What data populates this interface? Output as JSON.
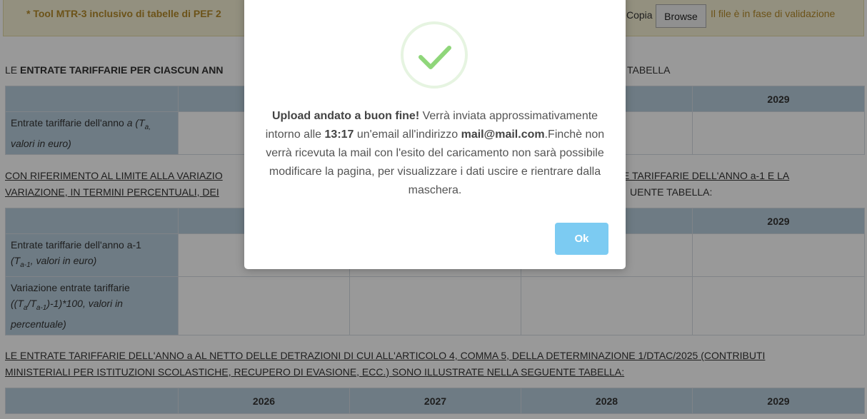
{
  "notice": {
    "text": "* Tool MTR-3 inclusivo di tabelle di PEF 2",
    "copy_label": "Copia (",
    "browse_label": "Browse",
    "status": "Il file è in fase di validazione"
  },
  "section1": {
    "heading_prefix": "LE ",
    "heading_bold": "ENTRATE TARIFFARIE PER CIASCUN ANN",
    "heading_suffix": "TABELLA",
    "years": [
      "",
      "",
      "",
      "2029"
    ],
    "row_label_a": "Entrate tariffarie dell'anno ",
    "row_label_b": "a (T",
    "row_label_c": "a,",
    "row_label_d": "valori in euro)"
  },
  "section2": {
    "heading_line1_left": "CON RIFERIMENTO AL LIMITE ALLA VARIAZIO",
    "heading_line1_right": "E TARIFFARIE DELL'ANNO a-1 E LA",
    "heading_line2_left": "VARIAZIONE, IN TERMINI PERCENTUALI, DEI",
    "heading_line2_right": "UENTE TABELLA:",
    "years": [
      "",
      "",
      "",
      "2029"
    ],
    "row1_label_a": "Entrate tariffarie dell'anno a-1",
    "row1_label_b": "(T",
    "row1_label_sub": "a-1",
    "row1_label_c": ", valori in euro)",
    "row2_label_a": "Variazione entrate tariffarie",
    "row2_label_b": "((T",
    "row2_label_sub1": "a",
    "row2_label_c": "/T",
    "row2_label_sub2": "a-1",
    "row2_label_d": ")-1)*100, valori in",
    "row2_label_e": "percentuale)"
  },
  "section3": {
    "heading_line1": "LE ENTRATE TARIFFARIE DELL'ANNO a AL NETTO DELLE DETRAZIONI DI CUI ALL'ARTICOLO 4, COMMA 5, DELLA DETERMINAZIONE 1/DTAC/2025 (CONTRIBUTI",
    "heading_line2": "MINISTERIALI PER ISTITUZIONI SCOLASTICHE, RECUPERO DI EVASIONE, ECC.) SONO ILLUSTRATE NELLA SEGUENTE TABELLA:",
    "years": [
      "2026",
      "2027",
      "2028",
      "2029"
    ]
  },
  "modal": {
    "title": "Upload andato a buon fine!",
    "text1": " Verrà inviata approssimativamente intorno alle ",
    "time": "13:17",
    "text2": " un'email all'indirizzo ",
    "email": "mail@mail.com",
    "text3": ".Finchè non verrà ricevuta la mail con l'esito del caricamento non sarà possibile modificare la pagina, per visualizzare i dati uscire e rientrare dalla maschera.",
    "ok_label": "Ok",
    "icon": "success-check-icon"
  }
}
